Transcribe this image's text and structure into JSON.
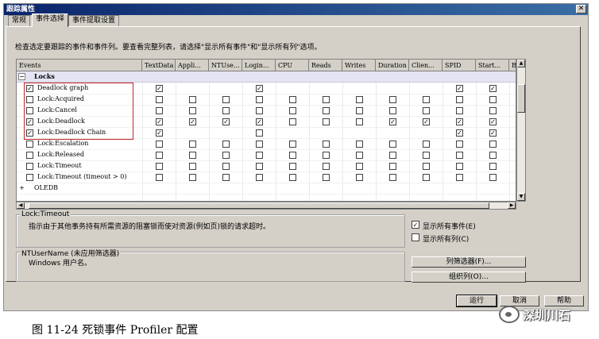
{
  "dialog": {
    "title": "跟踪属性",
    "close_glyph": "✕"
  },
  "tabs": [
    "常规",
    "事件选择",
    "事件提取设置"
  ],
  "description": "检查选定要跟踪的事件和事件列。要查看完整列表，请选择\"显示所有事件\"和\"显示所有列\"选项。",
  "grid": {
    "columns": [
      "Events",
      "TextData",
      "Appli...",
      "NTUse...",
      "Login...",
      "CPU",
      "Reads",
      "Writes",
      "Duration",
      "Clien...",
      "SPID",
      "Start...",
      "B"
    ],
    "group": {
      "name": "Locks",
      "expander": "−"
    },
    "rows": [
      {
        "event": "Deadlock graph",
        "checked": true,
        "cols": [
          1,
          0,
          0,
          1,
          0,
          0,
          0,
          0,
          0,
          1,
          1
        ]
      },
      {
        "event": "Lock:Acquired",
        "checked": false,
        "cols": [
          0,
          0,
          0,
          0,
          0,
          0,
          0,
          0,
          0,
          0,
          0
        ]
      },
      {
        "event": "Lock:Cancel",
        "checked": false,
        "cols": [
          0,
          0,
          0,
          0,
          0,
          0,
          0,
          0,
          0,
          0,
          0
        ]
      },
      {
        "event": "Lock:Deadlock",
        "checked": true,
        "cols": [
          1,
          1,
          1,
          1,
          0,
          0,
          0,
          1,
          1,
          1,
          1
        ]
      },
      {
        "event": "Lock:Deadlock Chain",
        "checked": true,
        "cols": [
          1,
          0,
          0,
          0,
          0,
          0,
          0,
          0,
          0,
          1,
          1
        ]
      },
      {
        "event": "Lock:Escalation",
        "checked": false,
        "cols": [
          0,
          0,
          0,
          0,
          0,
          0,
          0,
          0,
          0,
          0,
          0
        ]
      },
      {
        "event": "Lock:Released",
        "checked": false,
        "cols": [
          0,
          0,
          0,
          0,
          0,
          0,
          0,
          0,
          0,
          0,
          0
        ]
      },
      {
        "event": "Lock:Timeout",
        "checked": false,
        "cols": [
          0,
          0,
          0,
          0,
          0,
          0,
          0,
          0,
          0,
          0,
          0
        ]
      },
      {
        "event": "Lock:Timeout (timeout > 0)",
        "checked": false,
        "cols": [
          0,
          0,
          0,
          0,
          0,
          0,
          0,
          0,
          0,
          0,
          0
        ]
      }
    ],
    "collapsed_group": {
      "name": "OLEDB",
      "expander": "+"
    }
  },
  "event_info": {
    "title": "Lock:Timeout",
    "text": "指示由于其他事务持有所需资源的阻塞锁而使对资源(例如页)锁的请求超时。"
  },
  "column_info": {
    "title": "NTUserName (未应用筛选器)",
    "text": "Windows 用户名。"
  },
  "options": {
    "show_all_events": {
      "label": "显示所有事件(E)",
      "checked": true
    },
    "show_all_columns": {
      "label": "显示所有列(C)",
      "checked": false
    }
  },
  "buttons": {
    "column_filters": "列筛选器(F)...",
    "organize_columns": "组织列(O)...",
    "run": "运行",
    "cancel": "取消",
    "help": "帮助"
  },
  "caption": "图 11-24  死锁事件 Profiler 配置",
  "watermark": "深圳川石"
}
